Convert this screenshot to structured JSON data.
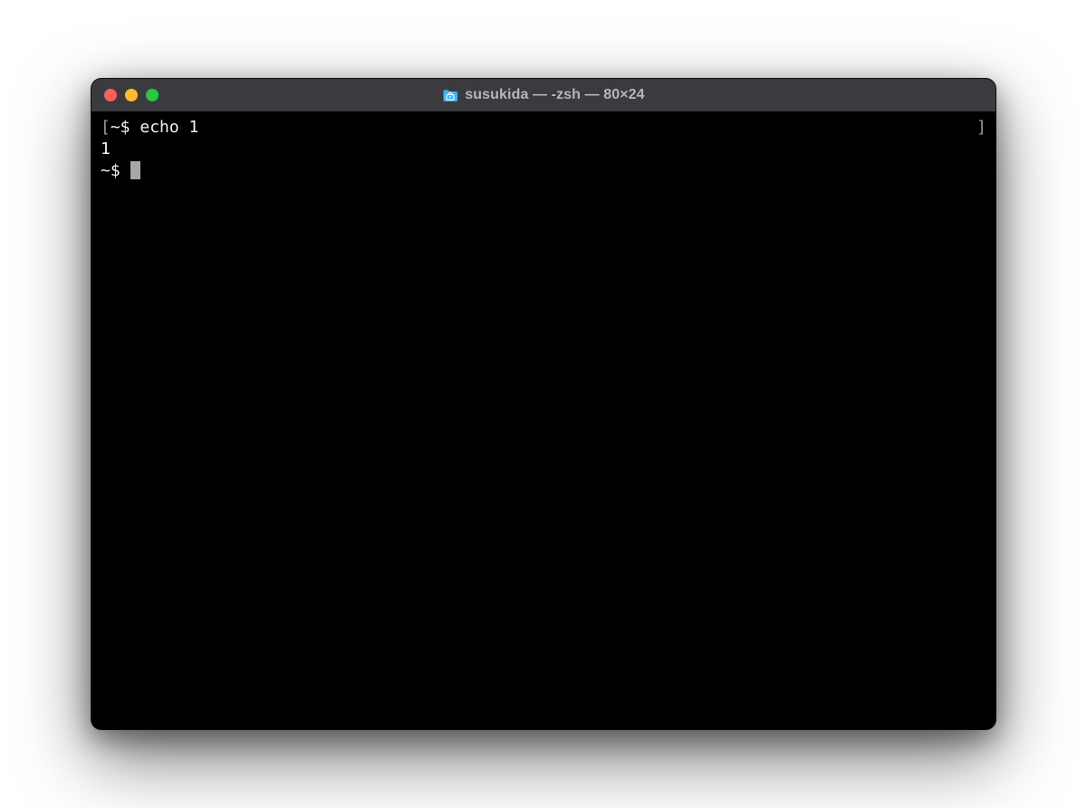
{
  "window": {
    "title": "susukida — -zsh — 80×24"
  },
  "terminal": {
    "left_bracket": "[",
    "right_bracket": "]",
    "line1_prompt": "~$ ",
    "line1_command": "echo 1",
    "line2_output": "1",
    "line3_prompt": "~$ "
  }
}
